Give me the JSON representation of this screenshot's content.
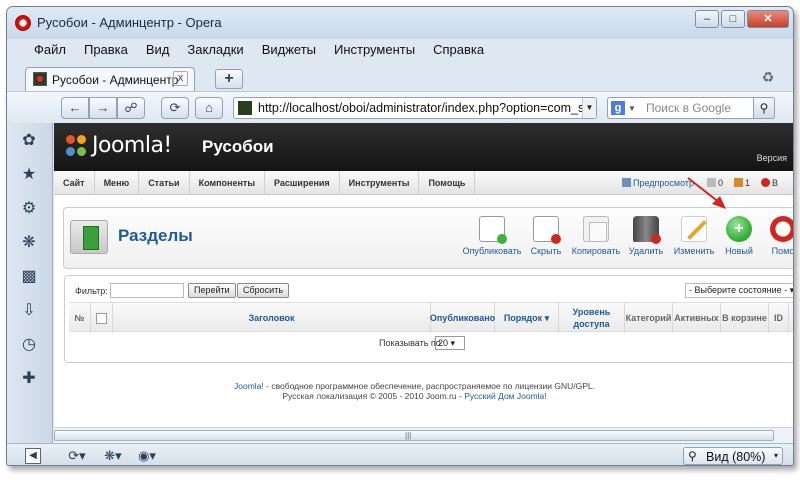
{
  "window": {
    "title": "Русобои - Админцентр - Opera"
  },
  "menubar": [
    "Файл",
    "Правка",
    "Вид",
    "Закладки",
    "Виджеты",
    "Инструменты",
    "Справка"
  ],
  "tab": {
    "title": "Русобои - Админцентр",
    "close": "x",
    "new_tab": "+"
  },
  "address": {
    "url": "http://localhost/oboi/administrator/index.php?option=com_s",
    "search_placeholder": "Поиск в Google",
    "search_engine_glyph": "g"
  },
  "joomla": {
    "logo_text": "Joomla!",
    "site_title": "Русобои",
    "version_label": "Версия",
    "menu": [
      "Сайт",
      "Меню",
      "Статьи",
      "Компоненты",
      "Расширения",
      "Инструменты",
      "Помощь"
    ],
    "status": {
      "preview": "Предпросмотр",
      "messages": "0",
      "users_online": "1",
      "logout_initial": "В"
    },
    "section_title": "Разделы",
    "toolbar": [
      {
        "label": "Опубликовать",
        "icon": "publish-icon"
      },
      {
        "label": "Скрыть",
        "icon": "unpublish-icon"
      },
      {
        "label": "Копировать",
        "icon": "copy-icon"
      },
      {
        "label": "Удалить",
        "icon": "delete-icon"
      },
      {
        "label": "Изменить",
        "icon": "edit-icon"
      },
      {
        "label": "Новый",
        "icon": "new-icon"
      },
      {
        "label": "Помо",
        "icon": "help-icon"
      }
    ],
    "filter": {
      "label": "Фильтр:",
      "value": "",
      "go_button": "Перейти",
      "reset_button": "Сбросить",
      "state_select": "- Выберите состояние -"
    },
    "table": {
      "columns": [
        "№",
        "",
        "Заголовок",
        "Опубликовано",
        "Порядок",
        "Уровень доступа",
        "Категорий",
        "Активных",
        "В корзине",
        "ID"
      ]
    },
    "pagination": {
      "label": "Показывать по",
      "value": "20"
    },
    "footer": {
      "link1": "Joomla!",
      "text1": " - свободное программное обеспечение, распространяемое по лицензии GNU/GPL.",
      "text2": "Русская локализация © 2005 - 2010 Joom.ru - ",
      "link2": "Русский Дом Joomla!"
    }
  },
  "statusbar": {
    "zoom": "Вид (80%)"
  },
  "colors": {
    "link": "#1c5a9a",
    "annotation": "#d0261e",
    "new_button": "#3bb33b"
  }
}
